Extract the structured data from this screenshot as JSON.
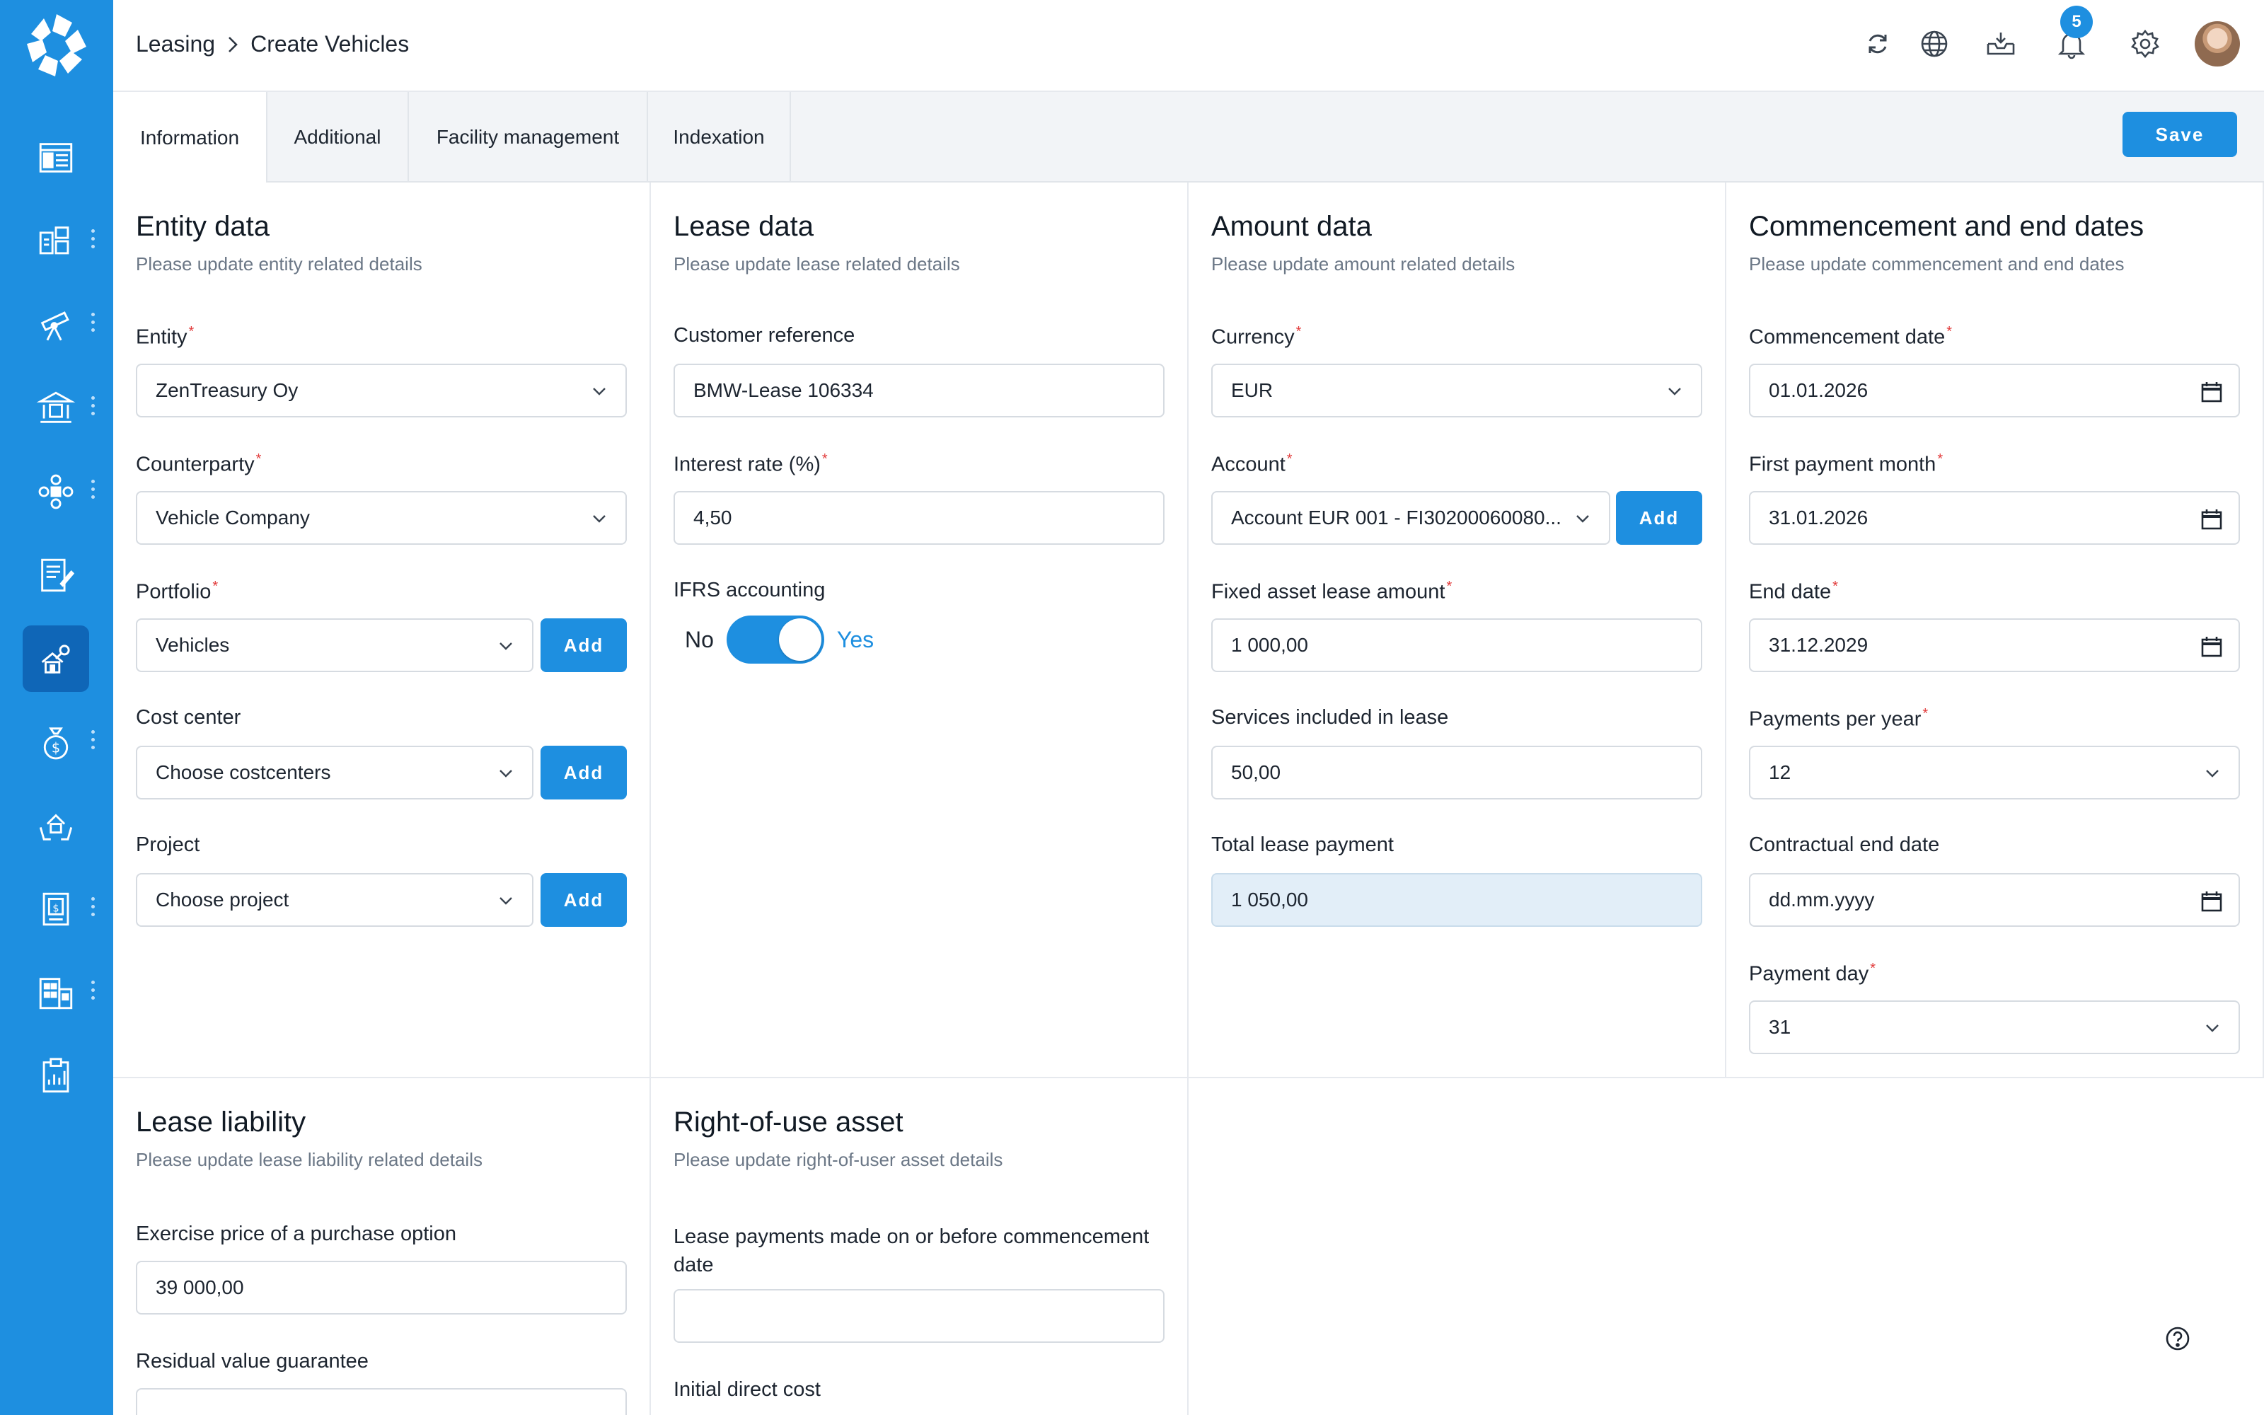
{
  "breadcrumb": {
    "root": "Leasing",
    "current": "Create Vehicles"
  },
  "notifications": {
    "count": "5"
  },
  "tabs": [
    "Information",
    "Additional",
    "Facility management",
    "Indexation"
  ],
  "save_label": "Save",
  "add_label": "Add",
  "entity": {
    "title": "Entity data",
    "subtitle": "Please update entity related details",
    "entity_label": "Entity",
    "entity_value": "ZenTreasury Oy",
    "counterparty_label": "Counterparty",
    "counterparty_value": "Vehicle Company",
    "portfolio_label": "Portfolio",
    "portfolio_value": "Vehicles",
    "costcenter_label": "Cost center",
    "costcenter_value": "Choose costcenters",
    "project_label": "Project",
    "project_value": "Choose project"
  },
  "lease": {
    "title": "Lease data",
    "subtitle": "Please update lease related details",
    "customer_ref_label": "Customer reference",
    "customer_ref_value": "BMW-Lease 106334",
    "interest_label": "Interest rate (%)",
    "interest_value": "4,50",
    "ifrs_label": "IFRS accounting",
    "toggle_no": "No",
    "toggle_yes": "Yes"
  },
  "amount": {
    "title": "Amount data",
    "subtitle": "Please update amount related details",
    "currency_label": "Currency",
    "currency_value": "EUR",
    "account_label": "Account",
    "account_value": "Account EUR 001 - FI30200060080...",
    "fixed_label": "Fixed asset lease amount",
    "fixed_value": "1 000,00",
    "services_label": "Services included in lease",
    "services_value": "50,00",
    "total_label": "Total lease payment",
    "total_value": "1 050,00"
  },
  "dates": {
    "title": "Commencement and end dates",
    "subtitle": "Please update commencement and end dates",
    "commencement_label": "Commencement date",
    "commencement_value": "01.01.2026",
    "first_payment_label": "First payment month",
    "first_payment_value": "31.01.2026",
    "end_label": "End date",
    "end_value": "31.12.2029",
    "ppy_label": "Payments per year",
    "ppy_value": "12",
    "contractual_label": "Contractual end date",
    "contractual_value": "dd.mm.yyyy",
    "payday_label": "Payment day",
    "payday_value": "31"
  },
  "liability": {
    "title": "Lease liability",
    "subtitle": "Please update lease liability related details",
    "exercise_label": "Exercise price of a purchase option",
    "exercise_value": "39 000,00",
    "residual_label": "Residual value guarantee"
  },
  "rou": {
    "title": "Right-of-use asset",
    "subtitle": "Please update right-of-user asset details",
    "payments_label": "Lease payments made on or before commencement date",
    "initial_label": "Initial direct cost"
  },
  "colors": {
    "brand": "#1e8fe0",
    "sidebar_active": "#0f66b7",
    "required": "#e23b3b"
  },
  "sidebar_icons": [
    "dashboard-icon",
    "analytics-icon",
    "telescope-icon",
    "bank-icon",
    "network-icon",
    "document-edit-icon",
    "leasing-icon",
    "money-bag-icon",
    "hands-house-icon",
    "report-icon",
    "building-icon",
    "clipboard-icon"
  ]
}
